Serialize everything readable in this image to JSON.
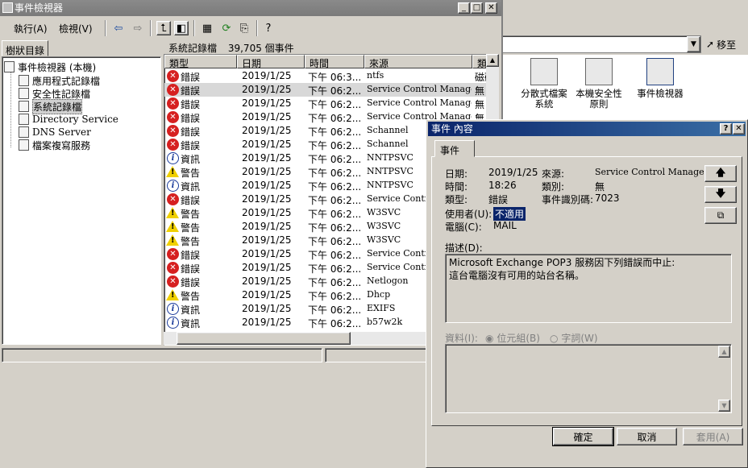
{
  "background": {
    "go_label": "移至",
    "icons": [
      {
        "label": "分散式檔案\n系統",
        "icon": "dfs-icon"
      },
      {
        "label": "本機安全性\n原則",
        "icon": "local-security-icon"
      },
      {
        "label": "事件檢視器",
        "icon": "event-viewer-icon"
      }
    ]
  },
  "window": {
    "title": "事件檢視器",
    "menu": {
      "action": "執行(A)",
      "view": "檢視(V)"
    },
    "tree_tab": "樹狀目錄",
    "list_title": "系統記錄檔",
    "list_count": "39,705 個事件"
  },
  "tree": {
    "root": "事件檢視器 (本機)",
    "items": [
      "應用程式記錄檔",
      "安全性記錄檔",
      "系統記錄檔",
      "Directory Service",
      "DNS Server",
      "檔案複寫服務"
    ]
  },
  "columns": [
    "類型",
    "日期",
    "時間",
    "來源",
    "類型"
  ],
  "rows": [
    {
      "type": "錯誤",
      "kind": "err",
      "date": "2019/1/25",
      "time": "下午 06:3...",
      "source": "ntfs",
      "cat": "磁碟"
    },
    {
      "type": "錯誤",
      "kind": "err",
      "date": "2019/1/25",
      "time": "下午 06:2...",
      "source": "Service Control Manager",
      "cat": "無"
    },
    {
      "type": "錯誤",
      "kind": "err",
      "date": "2019/1/25",
      "time": "下午 06:2...",
      "source": "Service Control Manager",
      "cat": "無"
    },
    {
      "type": "錯誤",
      "kind": "err",
      "date": "2019/1/25",
      "time": "下午 06:2...",
      "source": "Service Control Manager",
      "cat": "無"
    },
    {
      "type": "錯誤",
      "kind": "err",
      "date": "2019/1/25",
      "time": "下午 06:2...",
      "source": "Schannel",
      "cat": ""
    },
    {
      "type": "錯誤",
      "kind": "err",
      "date": "2019/1/25",
      "time": "下午 06:2...",
      "source": "Schannel",
      "cat": ""
    },
    {
      "type": "資訊",
      "kind": "info",
      "date": "2019/1/25",
      "time": "下午 06:2...",
      "source": "NNTPSVC",
      "cat": ""
    },
    {
      "type": "警告",
      "kind": "warn",
      "date": "2019/1/25",
      "time": "下午 06:2...",
      "source": "NNTPSVC",
      "cat": ""
    },
    {
      "type": "資訊",
      "kind": "info",
      "date": "2019/1/25",
      "time": "下午 06:2...",
      "source": "NNTPSVC",
      "cat": ""
    },
    {
      "type": "錯誤",
      "kind": "err",
      "date": "2019/1/25",
      "time": "下午 06:2...",
      "source": "Service Control",
      "cat": ""
    },
    {
      "type": "警告",
      "kind": "warn",
      "date": "2019/1/25",
      "time": "下午 06:2...",
      "source": "W3SVC",
      "cat": ""
    },
    {
      "type": "警告",
      "kind": "warn",
      "date": "2019/1/25",
      "time": "下午 06:2...",
      "source": "W3SVC",
      "cat": ""
    },
    {
      "type": "警告",
      "kind": "warn",
      "date": "2019/1/25",
      "time": "下午 06:2...",
      "source": "W3SVC",
      "cat": ""
    },
    {
      "type": "錯誤",
      "kind": "err",
      "date": "2019/1/25",
      "time": "下午 06:2...",
      "source": "Service Control",
      "cat": ""
    },
    {
      "type": "錯誤",
      "kind": "err",
      "date": "2019/1/25",
      "time": "下午 06:2...",
      "source": "Service Control",
      "cat": ""
    },
    {
      "type": "錯誤",
      "kind": "err",
      "date": "2019/1/25",
      "time": "下午 06:2...",
      "source": "Netlogon",
      "cat": ""
    },
    {
      "type": "警告",
      "kind": "warn",
      "date": "2019/1/25",
      "time": "下午 06:2...",
      "source": "Dhcp",
      "cat": ""
    },
    {
      "type": "資訊",
      "kind": "info",
      "date": "2019/1/25",
      "time": "下午 06:2...",
      "source": "EXIFS",
      "cat": ""
    },
    {
      "type": "資訊",
      "kind": "info",
      "date": "2019/1/25",
      "time": "下午 06:2...",
      "source": "b57w2k",
      "cat": ""
    }
  ],
  "dialog": {
    "title": "事件 內容",
    "tab": "事件",
    "date_label": "日期:",
    "date": "2019/1/25",
    "source_label": "來源:",
    "source": "Service Control Manager",
    "time_label": "時間:",
    "time": "18:26",
    "category_label": "類別:",
    "category": "無",
    "type_label": "類型:",
    "type": "錯誤",
    "event_id_label": "事件識別碼:",
    "event_id": "7023",
    "user_label": "使用者(U):",
    "user": "不適用",
    "computer_label": "電腦(C):",
    "computer": "MAIL",
    "description_label": "描述(D):",
    "description_line1": "Microsoft Exchange POP3 服務因下列錯誤而中止:",
    "description_line2": "這台電腦沒有可用的站台名稱。",
    "data_label": "資料(I):",
    "bytes_label": "位元組(B)",
    "words_label": "字詞(W)",
    "ok": "確定",
    "cancel": "取消",
    "apply": "套用(A)"
  }
}
